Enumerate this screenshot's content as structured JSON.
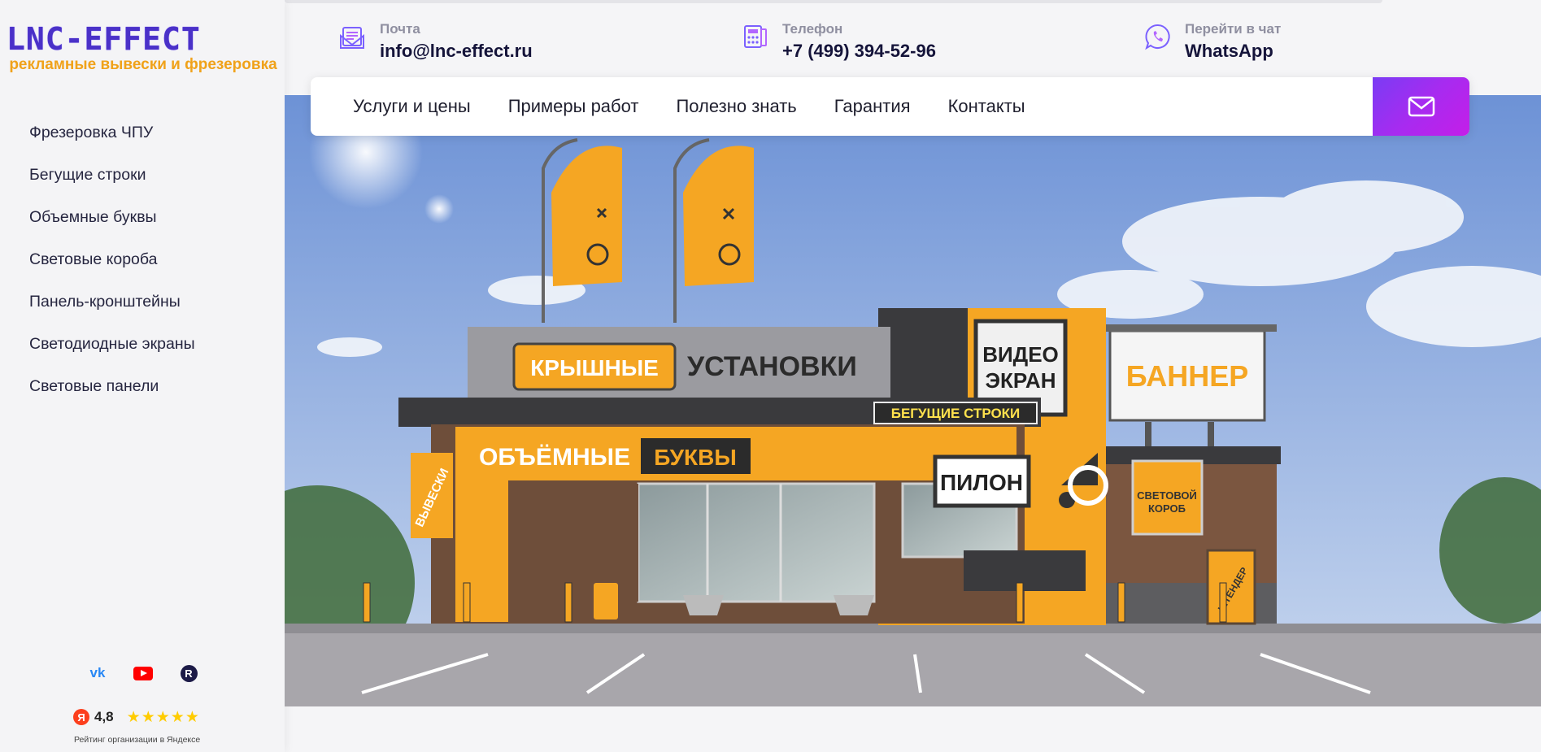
{
  "logo": {
    "mark": "LNC-EFFECT",
    "tagline": "рекламные вывески и фрезеровка"
  },
  "sidebar": {
    "items": [
      {
        "label": "Фрезеровка ЧПУ"
      },
      {
        "label": "Бегущие строки"
      },
      {
        "label": "Объемные буквы"
      },
      {
        "label": "Световые короба"
      },
      {
        "label": "Панель-кронштейны"
      },
      {
        "label": "Светодиодные экраны"
      },
      {
        "label": "Световые панели"
      }
    ],
    "socials": [
      "vk-icon",
      "youtube-icon",
      "rutube-icon"
    ],
    "rating": {
      "badge": "Я",
      "value": "4,8",
      "stars": 5,
      "caption": "Рейтинг организации в Яндексе"
    }
  },
  "header": {
    "email": {
      "label": "Почта",
      "value": "info@lnc-effect.ru",
      "icon": "mail-icon"
    },
    "phone": {
      "label": "Телефон",
      "value": "+7 (499) 394-52-96",
      "icon": "calculator-icon"
    },
    "chat": {
      "label": "Перейти в чат",
      "value": "WhatsApp",
      "icon": "whatsapp-icon"
    }
  },
  "menu": {
    "items": [
      {
        "label": "Услуги и цены"
      },
      {
        "label": "Примеры работ"
      },
      {
        "label": "Полезно знать"
      },
      {
        "label": "Гарантия"
      },
      {
        "label": "Контакты"
      }
    ],
    "mail_button_icon": "envelope-icon"
  },
  "hero": {
    "signs": {
      "roof_left": "КРЫШНЫЕ",
      "roof_right": "УСТАНОВКИ",
      "volume_left": "ОБЪЁМНЫЕ",
      "volume_right": "БУКВЫ",
      "ticker": "БЕГУЩИЕ СТРОКИ",
      "pylon": "ПИЛОН",
      "video_line1": "ВИДЕО",
      "video_line2": "ЭКРАН",
      "banner": "БАННЕР",
      "lightbox_line1": "СВЕТОВОЙ",
      "lightbox_line2": "КОРОБ",
      "signs_left": "ВЫВЕСКИ",
      "stand": "ШТЕНДЕР"
    },
    "colors": {
      "brand_orange": "#f5a623",
      "facade_dark": "#3a3a3d",
      "sky_top": "#6d92d6",
      "sky_bottom": "#c9d8ef"
    }
  }
}
